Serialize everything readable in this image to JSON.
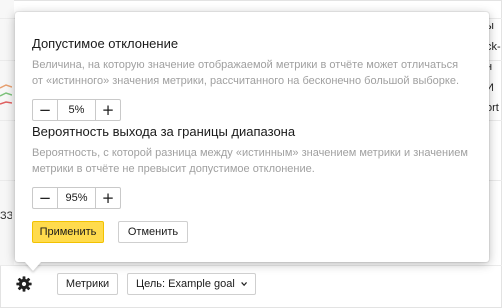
{
  "background": {
    "left_text": "ЗЗ",
    "right_texts": [
      "ы",
      "ck-",
      "н",
      "И",
      "ort"
    ]
  },
  "popup": {
    "section1": {
      "title": "Допустимое отклонение",
      "description": "Величина, на которую значение отображаемой метрики в отчёте может отличаться от «истинного» значения метрики, рассчитанного на бесконечно большой выборке.",
      "minus_label": "−",
      "value": "5%",
      "plus_label": "+"
    },
    "section2": {
      "title": "Вероятность выхода за границы диапазона",
      "description": "Вероятность, с которой разница между «истинным» значением метрики и значением метрики в отчёте не превысит допустимое отклонение.",
      "minus_label": "−",
      "value": "95%",
      "plus_label": "+"
    },
    "apply_label": "Применить",
    "cancel_label": "Отменить"
  },
  "toolbar": {
    "metrics_label": "Метрики",
    "goal_label": "Цель: Example goal"
  },
  "icons": {
    "settings": "gear-icon",
    "dropdown": "chevron-down-icon"
  },
  "colors": {
    "apply_bg": "#ffdb4d",
    "desc_text": "#a0a0a0"
  }
}
